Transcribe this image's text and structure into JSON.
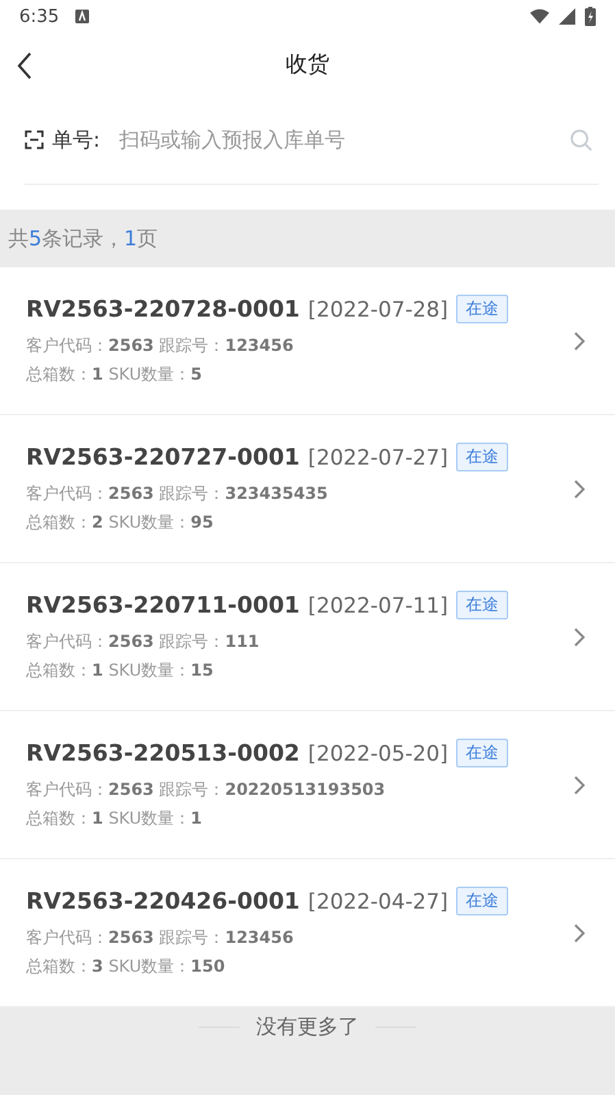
{
  "status_bar": {
    "time": "6:35"
  },
  "header": {
    "title": "收货"
  },
  "search": {
    "label": "单号:",
    "placeholder": "扫码或输入预报入库单号"
  },
  "summary": [
    {
      "text": "共",
      "highlight": false
    },
    {
      "text": "5",
      "highlight": true
    },
    {
      "text": "条记录，",
      "highlight": false
    },
    {
      "text": "1",
      "highlight": true
    },
    {
      "text": "页",
      "highlight": false
    }
  ],
  "records": [
    {
      "number": "RV2563-220728-0001",
      "date": "[2022-07-28]",
      "status": "在途",
      "line_1": [
        {
          "label": "客户代码：",
          "value": "2563"
        },
        {
          "label": "跟踪号：",
          "value": "123456"
        }
      ],
      "line_2": [
        {
          "label": "总箱数：",
          "value": "1"
        },
        {
          "label": "SKU数量：",
          "value": "5"
        }
      ]
    },
    {
      "number": "RV2563-220727-0001",
      "date": "[2022-07-27]",
      "status": "在途",
      "line_1": [
        {
          "label": "客户代码：",
          "value": "2563"
        },
        {
          "label": "跟踪号：",
          "value": "323435435"
        }
      ],
      "line_2": [
        {
          "label": "总箱数：",
          "value": "2"
        },
        {
          "label": "SKU数量：",
          "value": "95"
        }
      ]
    },
    {
      "number": "RV2563-220711-0001",
      "date": "[2022-07-11]",
      "status": "在途",
      "line_1": [
        {
          "label": "客户代码：",
          "value": "2563"
        },
        {
          "label": "跟踪号：",
          "value": "111"
        }
      ],
      "line_2": [
        {
          "label": "总箱数：",
          "value": "1"
        },
        {
          "label": "SKU数量：",
          "value": "15"
        }
      ]
    },
    {
      "number": "RV2563-220513-0002",
      "date": "[2022-05-20]",
      "status": "在途",
      "line_1": [
        {
          "label": "客户代码：",
          "value": "2563"
        },
        {
          "label": "跟踪号：",
          "value": "20220513193503"
        }
      ],
      "line_2": [
        {
          "label": "总箱数：",
          "value": "1"
        },
        {
          "label": "SKU数量：",
          "value": "1"
        }
      ]
    },
    {
      "number": "RV2563-220426-0001",
      "date": "[2022-04-27]",
      "status": "在途",
      "line_1": [
        {
          "label": "客户代码：",
          "value": "2563"
        },
        {
          "label": "跟踪号：",
          "value": "123456"
        }
      ],
      "line_2": [
        {
          "label": "总箱数：",
          "value": "3"
        },
        {
          "label": "SKU数量：",
          "value": "150"
        }
      ]
    }
  ],
  "footer": {
    "text": "没有更多了"
  }
}
